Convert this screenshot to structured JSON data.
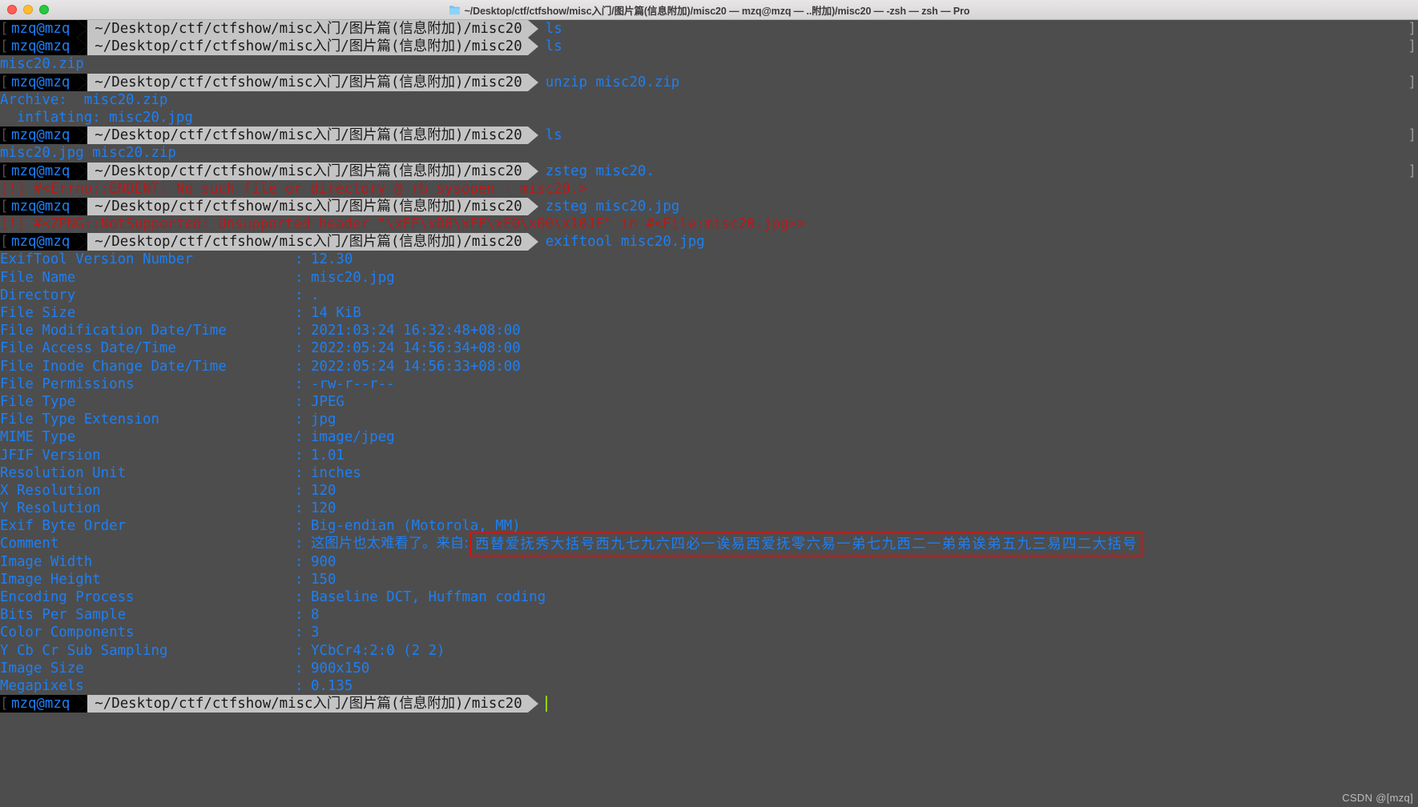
{
  "window": {
    "title": "~/Desktop/ctf/ctfshow/misc入门/图片篇(信息附加)/misc20 — mzq@mzq — ..附加)/misc20 — -zsh — zsh — Pro",
    "folder_icon": "folder-icon",
    "buttons": {
      "close": "close-button",
      "minimize": "minimize-button",
      "zoom": "zoom-button"
    }
  },
  "prompt": {
    "user": "mzq@mzq",
    "path": "~/Desktop/ctf/ctfshow/misc入门/图片篇(信息附加)/misc20",
    "lead": "[",
    "edge": "]"
  },
  "colors": {
    "background": "#4d4d4d",
    "prompt_user_bg": "#000000",
    "prompt_user_fg": "#1d7ff5",
    "prompt_path_bg": "#c4c4c4",
    "prompt_path_fg": "#1a1a1a",
    "command": "#1d7ff5",
    "output": "#1d7ff5",
    "error": "#b81a1a",
    "highlight_box": "#ff0000",
    "cursor": "#8fd600"
  },
  "session": {
    "commands": [
      {
        "index": 0,
        "cmd": "ls"
      },
      {
        "index": 1,
        "cmd": "ls"
      },
      {
        "index": 2,
        "cmd": "unzip misc20.zip"
      },
      {
        "index": 3,
        "cmd": "ls"
      },
      {
        "index": 4,
        "cmd": "zsteg misc20."
      },
      {
        "index": 5,
        "cmd": "zsteg misc20.jpg"
      },
      {
        "index": 6,
        "cmd": "exiftool misc20.jpg"
      },
      {
        "index": 7,
        "cmd": ""
      }
    ],
    "out_ls1": "misc20.zip",
    "out_unzip_1": "Archive:  misc20.zip",
    "out_unzip_2": "  inflating: misc20.jpg",
    "out_ls2": "misc20.jpg misc20.zip",
    "err_zsteg1": "[!] #<Errno::ENOENT: No such file or directory @ rb_sysopen - misc20.>",
    "err_zsteg2": "[!] #<ZPNG::NotSupported: Unsupported header \"\\xFF\\xD8\\xFF\\xE0\\x00\\x10JF\" in #<File:misc20.jpg>>"
  },
  "exif": {
    "rows": [
      {
        "key": "ExifTool Version Number",
        "value": "12.30"
      },
      {
        "key": "File Name",
        "value": "misc20.jpg"
      },
      {
        "key": "Directory",
        "value": "."
      },
      {
        "key": "File Size",
        "value": "14 KiB"
      },
      {
        "key": "File Modification Date/Time",
        "value": "2021:03:24 16:32:48+08:00"
      },
      {
        "key": "File Access Date/Time",
        "value": "2022:05:24 14:56:34+08:00"
      },
      {
        "key": "File Inode Change Date/Time",
        "value": "2022:05:24 14:56:33+08:00"
      },
      {
        "key": "File Permissions",
        "value": "-rw-r--r--"
      },
      {
        "key": "File Type",
        "value": "JPEG"
      },
      {
        "key": "File Type Extension",
        "value": "jpg"
      },
      {
        "key": "MIME Type",
        "value": "image/jpeg"
      },
      {
        "key": "JFIF Version",
        "value": "1.01"
      },
      {
        "key": "Resolution Unit",
        "value": "inches"
      },
      {
        "key": "X Resolution",
        "value": "120"
      },
      {
        "key": "Y Resolution",
        "value": "120"
      },
      {
        "key": "Exif Byte Order",
        "value": "Big-endian (Motorola, MM)"
      }
    ],
    "comment_key": "Comment",
    "comment_prefix": "这图片也太难看了。来自:",
    "comment_highlight": "西替爱抚秀大括号西九七九六四必一诶易西爱抚零六易一弟七九西二一弟弟诶弟五九三易四二大括号",
    "rows_after": [
      {
        "key": "Image Width",
        "value": "900"
      },
      {
        "key": "Image Height",
        "value": "150"
      },
      {
        "key": "Encoding Process",
        "value": "Baseline DCT, Huffman coding"
      },
      {
        "key": "Bits Per Sample",
        "value": "8"
      },
      {
        "key": "Color Components",
        "value": "3"
      },
      {
        "key": "Y Cb Cr Sub Sampling",
        "value": "YCbCr4:2:0 (2 2)"
      },
      {
        "key": "Image Size",
        "value": "900x150"
      },
      {
        "key": "Megapixels",
        "value": "0.135"
      }
    ]
  },
  "watermark": "CSDN @[mzq]"
}
